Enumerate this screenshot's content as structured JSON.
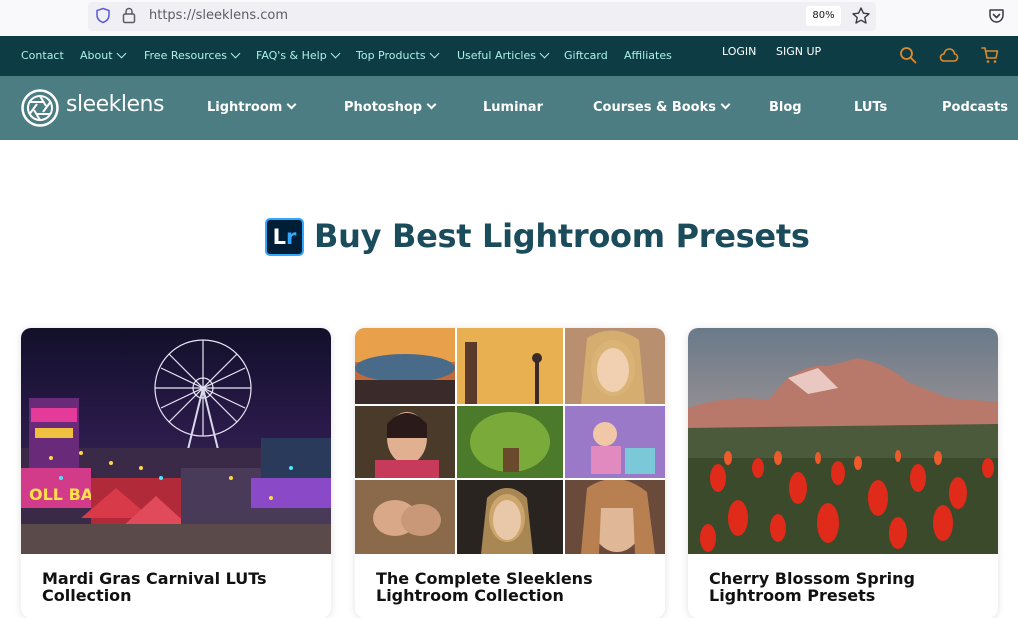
{
  "browser": {
    "url": "https://sleeklens.com",
    "zoom": "80%"
  },
  "topnav": {
    "items": [
      {
        "label": "Contact",
        "dropdown": false
      },
      {
        "label": "About",
        "dropdown": true
      },
      {
        "label": "Free Resources",
        "dropdown": true
      },
      {
        "label": "FAQ's & Help",
        "dropdown": true
      },
      {
        "label": "Top Products",
        "dropdown": true
      },
      {
        "label": "Useful Articles",
        "dropdown": true
      },
      {
        "label": "Giftcard",
        "dropdown": false
      },
      {
        "label": "Affiliates",
        "dropdown": false
      }
    ],
    "login": "LOGIN",
    "signup": "SIGN UP",
    "icons": [
      "search-icon",
      "cloud-icon",
      "cart-icon"
    ],
    "accent_color": "#e08a2c"
  },
  "mainnav": {
    "logo_text": "sleeklens",
    "items": [
      {
        "label": "Lightroom",
        "dropdown": true
      },
      {
        "label": "Photoshop",
        "dropdown": true
      },
      {
        "label": "Luminar",
        "dropdown": false
      },
      {
        "label": "Courses & Books",
        "dropdown": true
      },
      {
        "label": "Blog",
        "dropdown": false
      },
      {
        "label": "LUTs",
        "dropdown": false
      },
      {
        "label": "Podcasts",
        "dropdown": false
      }
    ]
  },
  "hero": {
    "badge_l": "L",
    "badge_r": "r",
    "title": "Buy Best Lightroom Presets"
  },
  "cards": [
    {
      "title": "Mardi Gras Carnival LUTs Collection"
    },
    {
      "title": "The Complete Sleeklens Lightroom Collection"
    },
    {
      "title": "Cherry Blossom Spring Lightroom Presets"
    }
  ],
  "colors": {
    "topnav_bg": "#0e3c44",
    "mainnav_bg": "#4b7d82",
    "title_color": "#1b4c5b",
    "lightroom_blue": "#31a8ff"
  }
}
